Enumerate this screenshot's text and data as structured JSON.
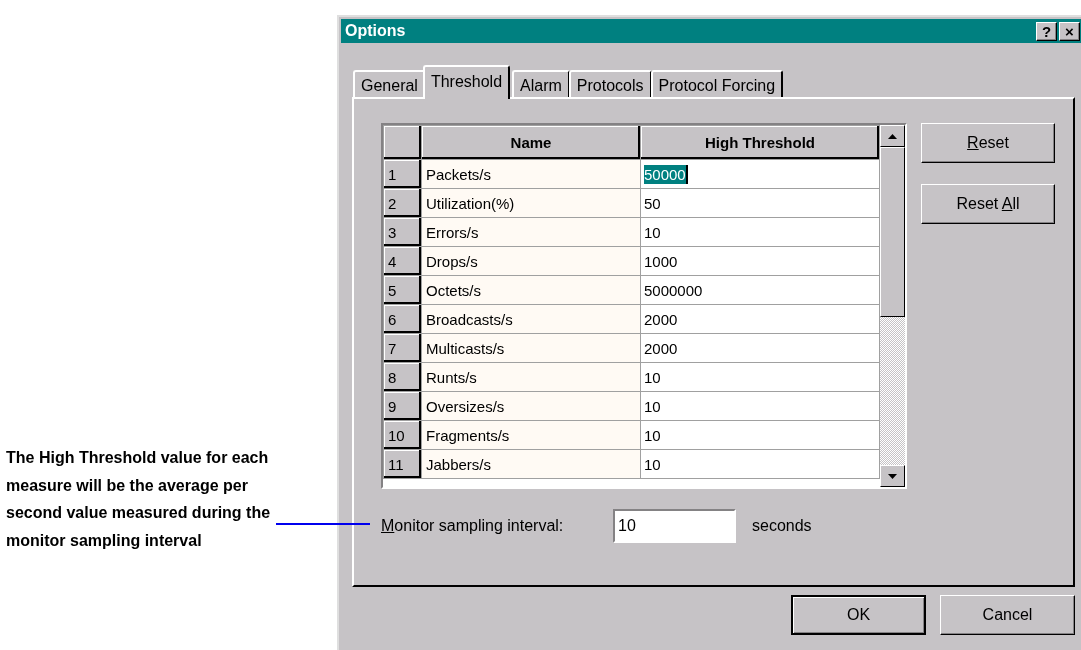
{
  "annotation": {
    "text": "The High Threshold value for each measure will be the average per second value measured during the monitor sampling interval"
  },
  "window": {
    "title": "Options",
    "title_buttons": [
      "?",
      "×"
    ]
  },
  "tabs": [
    {
      "label": "General",
      "selected": false
    },
    {
      "label": "Threshold",
      "selected": true
    },
    {
      "label": "Alarm",
      "selected": false
    },
    {
      "label": "Protocols",
      "selected": false
    },
    {
      "label": "Protocol Forcing",
      "selected": false
    }
  ],
  "table": {
    "columns": [
      "Name",
      "High Threshold"
    ],
    "rows": [
      {
        "index": "1",
        "name": "Packets/s",
        "value": "50000",
        "selected": true
      },
      {
        "index": "2",
        "name": "Utilization(%)",
        "value": "50",
        "selected": false
      },
      {
        "index": "3",
        "name": "Errors/s",
        "value": "10",
        "selected": false
      },
      {
        "index": "4",
        "name": "Drops/s",
        "value": "1000",
        "selected": false
      },
      {
        "index": "5",
        "name": "Octets/s",
        "value": "5000000",
        "selected": false
      },
      {
        "index": "6",
        "name": "Broadcasts/s",
        "value": "2000",
        "selected": false
      },
      {
        "index": "7",
        "name": "Multicasts/s",
        "value": "2000",
        "selected": false
      },
      {
        "index": "8",
        "name": "Runts/s",
        "value": "10",
        "selected": false
      },
      {
        "index": "9",
        "name": "Oversizes/s",
        "value": "10",
        "selected": false
      },
      {
        "index": "10",
        "name": "Fragments/s",
        "value": "10",
        "selected": false
      },
      {
        "index": "11",
        "name": "Jabbers/s",
        "value": "10",
        "selected": false
      }
    ]
  },
  "side_buttons": [
    {
      "label_parts": [
        {
          "text": "R",
          "underlined": true
        },
        {
          "text": "eset",
          "underlined": false
        }
      ]
    },
    {
      "label_parts": [
        {
          "text": "Reset ",
          "underlined": false
        },
        {
          "text": "A",
          "underlined": true
        },
        {
          "text": "ll",
          "underlined": false
        }
      ]
    }
  ],
  "interval": {
    "label_parts": [
      {
        "text": "M",
        "underlined": true
      },
      {
        "text": "onitor sampling interval:",
        "underlined": false
      }
    ],
    "value": "10",
    "unit": "seconds"
  },
  "buttons": [
    "OK",
    "Cancel"
  ]
}
